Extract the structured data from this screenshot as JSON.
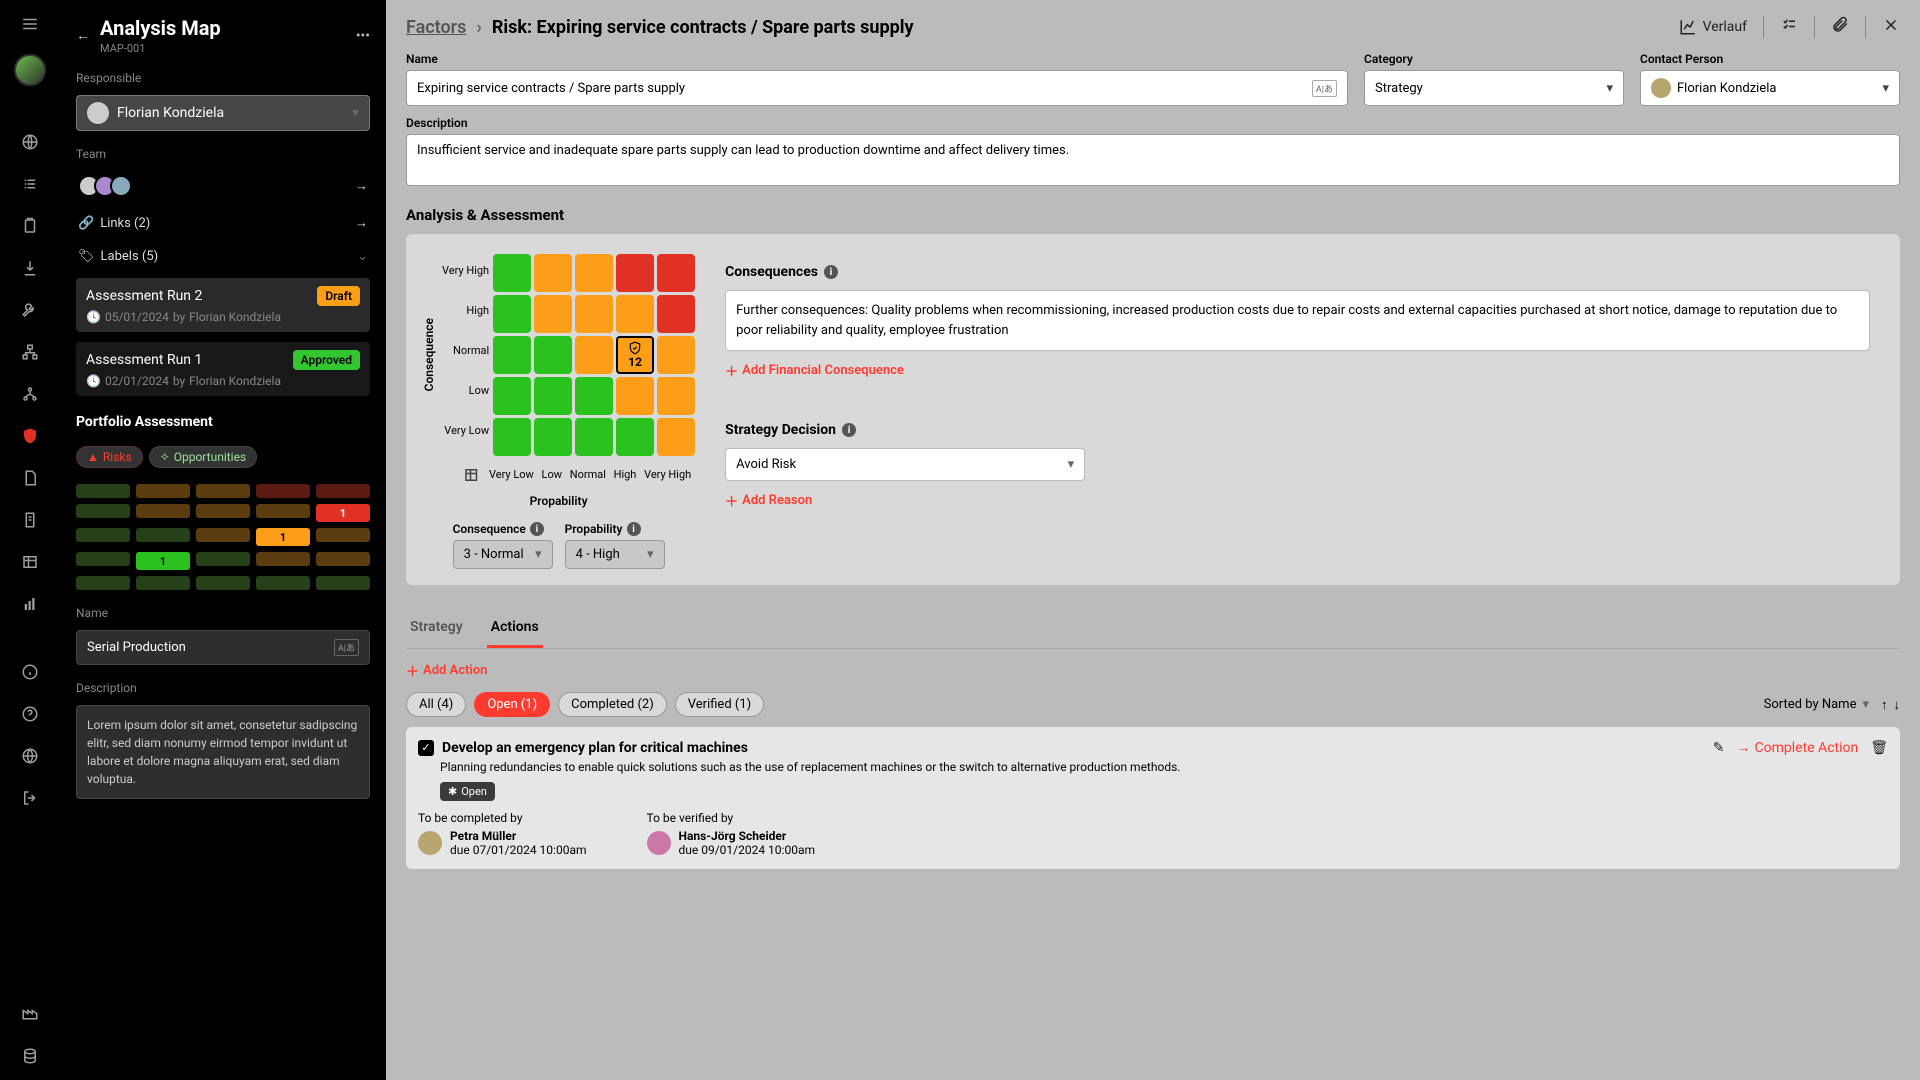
{
  "nav_rail": {
    "icons": [
      "menu",
      "avatar",
      "globe",
      "list",
      "clipboard",
      "download",
      "wrench",
      "sitemap",
      "org",
      "shield",
      "doc1",
      "doc2",
      "table",
      "bars",
      "info",
      "help",
      "language",
      "logout",
      "factory",
      "database"
    ]
  },
  "sidebar": {
    "title": "Analysis Map",
    "id": "MAP-001",
    "responsible_label": "Responsible",
    "responsible_value": "Florian Kondziela",
    "team_label": "Team",
    "links_label": "Links (2)",
    "labels_label": "Labels (5)",
    "runs": [
      {
        "title": "Assessment Run 2",
        "badge": "Draft",
        "badge_class": "draft",
        "date": "05/01/2024",
        "by": "Florian Kondziela"
      },
      {
        "title": "Assessment Run 1",
        "badge": "Approved",
        "badge_class": "approved",
        "date": "02/01/2024",
        "by": "Florian Kondziela"
      }
    ],
    "portfolio_title": "Portfolio Assessment",
    "risks_tab": "Risks",
    "opps_tab": "Opportunities",
    "portfolio_badges": {
      "green": "1",
      "orange": "1",
      "red": "1"
    },
    "name_label": "Name",
    "name_value": "Serial Production",
    "desc_label": "Description",
    "desc_value": "Lorem ipsum dolor sit amet, consetetur sadipscing elitr, sed diam nonumy eirmod tempor invidunt ut labore et dolore magna aliquyam erat, sed diam voluptua."
  },
  "breadcrumb": {
    "root": "Factors",
    "sep": "›",
    "current": "Risk: Expiring service contracts / Spare parts supply"
  },
  "header_actions": {
    "verlauf": "Verlauf"
  },
  "fields": {
    "name_label": "Name",
    "name_value": "Expiring service contracts / Spare parts supply",
    "category_label": "Category",
    "category_value": "Strategy",
    "contact_label": "Contact Person",
    "contact_value": "Florian Kondziela",
    "desc_label": "Description",
    "desc_value": "Insufficient service and inadequate spare parts supply can lead to production downtime and affect delivery times."
  },
  "assessment": {
    "title": "Analysis & Assessment",
    "y_axis": "Consequence",
    "x_axis": "Propability",
    "y_labels": [
      "Very High",
      "High",
      "Normal",
      "Low",
      "Very Low"
    ],
    "x_labels": [
      "Very Low",
      "Low",
      "Normal",
      "High",
      "Very High"
    ],
    "selected_value": "12",
    "consequence_label": "Consequence",
    "consequence_value": "3 - Normal",
    "propability_label": "Propability",
    "propability_value": "4 - High",
    "consequences_title": "Consequences",
    "consequences_text": "Further consequences: Quality problems when recommissioning, increased production costs due to repair costs and external capacities purchased at short notice, damage to reputation due to poor reliability and quality, employee frustration",
    "add_financial": "Add Financial Consequence",
    "strategy_title": "Strategy Decision",
    "strategy_value": "Avoid Risk",
    "add_reason": "Add Reason"
  },
  "tabs": {
    "strategy": "Strategy",
    "actions": "Actions"
  },
  "actions": {
    "add": "Add Action",
    "filters": {
      "all": "All (4)",
      "open": "Open (1)",
      "completed": "Completed (2)",
      "verified": "Verified (1)"
    },
    "sort_label": "Sorted by Name",
    "item": {
      "title": "Develop an emergency plan for critical machines",
      "desc": "Planning redundancies to enable quick solutions such as the use of replacement machines or the switch to alternative production methods.",
      "status": "Open",
      "complete_action": "Complete Action",
      "completed_by_label": "To be completed by",
      "completed_by_name": "Petra Müller",
      "completed_by_due": "due 07/01/2024 10:00am",
      "verified_by_label": "To be verified by",
      "verified_by_name": "Hans-Jörg Scheider",
      "verified_by_due": "due 09/01/2024 10:00am"
    }
  }
}
